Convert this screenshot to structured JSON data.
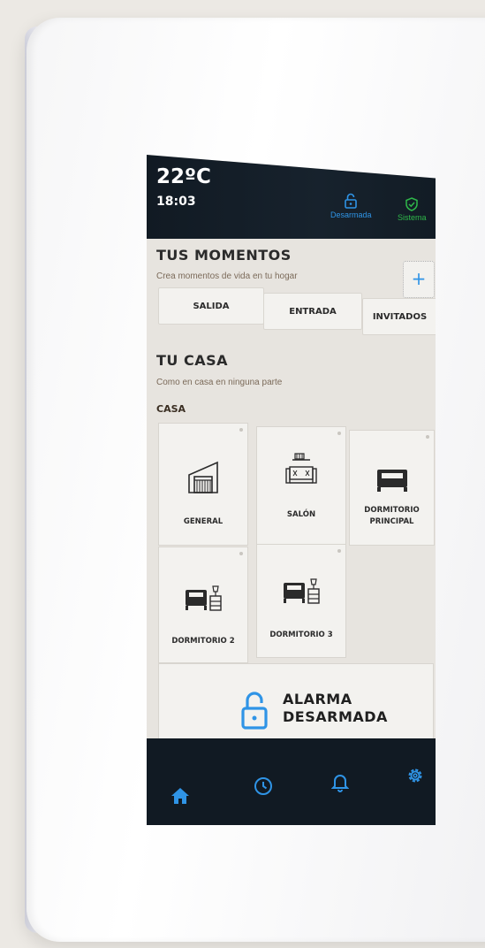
{
  "status": {
    "temperature": "22ºC",
    "time": "18:03",
    "lock_label": "Desarmada",
    "system_label": "Sistema"
  },
  "moments": {
    "title": "TUS MOMENTOS",
    "subtitle": "Crea momentos de vida en tu hogar",
    "add_label": "+",
    "buttons": [
      "SALIDA",
      "ENTRADA",
      "INVITADOS"
    ]
  },
  "house": {
    "title": "TU CASA",
    "subtitle": "Como en casa en ninguna parte",
    "section_label": "CASA",
    "rooms": [
      {
        "line1": "GENERAL",
        "line2": ""
      },
      {
        "line1": "SALÓN",
        "line2": ""
      },
      {
        "line1": "DORMITORIO",
        "line2": "PRINCIPAL"
      },
      {
        "line1": "DORMITORIO 2",
        "line2": ""
      },
      {
        "line1": "DORMITORIO 3",
        "line2": ""
      }
    ]
  },
  "alarm": {
    "line1": "ALARMA",
    "line2": "DESARMADA"
  },
  "colors": {
    "accent_blue": "#2f94e6",
    "status_green": "#2fb84a",
    "dark_bar": "#111a23"
  },
  "icons": [
    "lock-icon",
    "shield-check-icon",
    "plus-icon",
    "garage-icon",
    "sofa-icon",
    "bed-icon",
    "bed-nightstand-icon",
    "home-icon",
    "clock-icon",
    "bell-icon",
    "gear-icon"
  ]
}
